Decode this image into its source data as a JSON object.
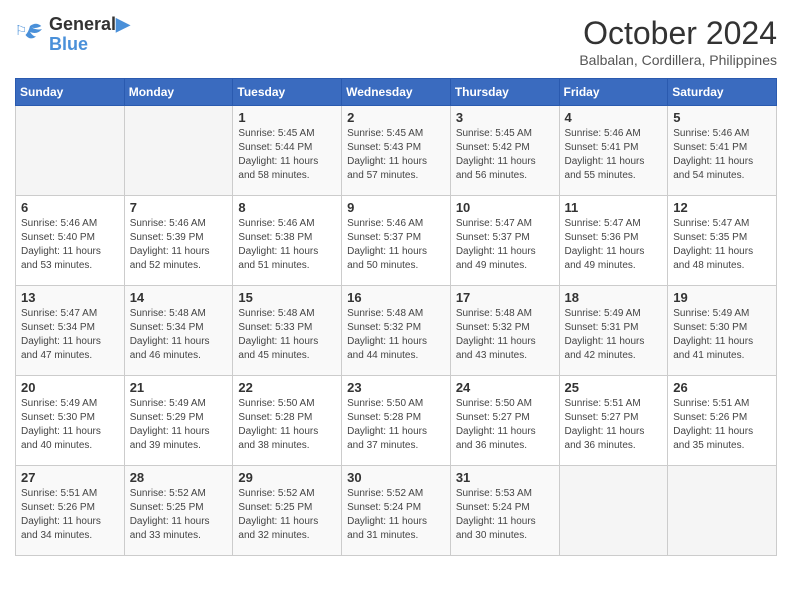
{
  "logo": {
    "line1": "General",
    "line2": "Blue"
  },
  "title": "October 2024",
  "subtitle": "Balbalan, Cordillera, Philippines",
  "weekdays": [
    "Sunday",
    "Monday",
    "Tuesday",
    "Wednesday",
    "Thursday",
    "Friday",
    "Saturday"
  ],
  "weeks": [
    [
      {
        "day": "",
        "info": ""
      },
      {
        "day": "",
        "info": ""
      },
      {
        "day": "1",
        "info": "Sunrise: 5:45 AM\nSunset: 5:44 PM\nDaylight: 11 hours and 58 minutes."
      },
      {
        "day": "2",
        "info": "Sunrise: 5:45 AM\nSunset: 5:43 PM\nDaylight: 11 hours and 57 minutes."
      },
      {
        "day": "3",
        "info": "Sunrise: 5:45 AM\nSunset: 5:42 PM\nDaylight: 11 hours and 56 minutes."
      },
      {
        "day": "4",
        "info": "Sunrise: 5:46 AM\nSunset: 5:41 PM\nDaylight: 11 hours and 55 minutes."
      },
      {
        "day": "5",
        "info": "Sunrise: 5:46 AM\nSunset: 5:41 PM\nDaylight: 11 hours and 54 minutes."
      }
    ],
    [
      {
        "day": "6",
        "info": "Sunrise: 5:46 AM\nSunset: 5:40 PM\nDaylight: 11 hours and 53 minutes."
      },
      {
        "day": "7",
        "info": "Sunrise: 5:46 AM\nSunset: 5:39 PM\nDaylight: 11 hours and 52 minutes."
      },
      {
        "day": "8",
        "info": "Sunrise: 5:46 AM\nSunset: 5:38 PM\nDaylight: 11 hours and 51 minutes."
      },
      {
        "day": "9",
        "info": "Sunrise: 5:46 AM\nSunset: 5:37 PM\nDaylight: 11 hours and 50 minutes."
      },
      {
        "day": "10",
        "info": "Sunrise: 5:47 AM\nSunset: 5:37 PM\nDaylight: 11 hours and 49 minutes."
      },
      {
        "day": "11",
        "info": "Sunrise: 5:47 AM\nSunset: 5:36 PM\nDaylight: 11 hours and 49 minutes."
      },
      {
        "day": "12",
        "info": "Sunrise: 5:47 AM\nSunset: 5:35 PM\nDaylight: 11 hours and 48 minutes."
      }
    ],
    [
      {
        "day": "13",
        "info": "Sunrise: 5:47 AM\nSunset: 5:34 PM\nDaylight: 11 hours and 47 minutes."
      },
      {
        "day": "14",
        "info": "Sunrise: 5:48 AM\nSunset: 5:34 PM\nDaylight: 11 hours and 46 minutes."
      },
      {
        "day": "15",
        "info": "Sunrise: 5:48 AM\nSunset: 5:33 PM\nDaylight: 11 hours and 45 minutes."
      },
      {
        "day": "16",
        "info": "Sunrise: 5:48 AM\nSunset: 5:32 PM\nDaylight: 11 hours and 44 minutes."
      },
      {
        "day": "17",
        "info": "Sunrise: 5:48 AM\nSunset: 5:32 PM\nDaylight: 11 hours and 43 minutes."
      },
      {
        "day": "18",
        "info": "Sunrise: 5:49 AM\nSunset: 5:31 PM\nDaylight: 11 hours and 42 minutes."
      },
      {
        "day": "19",
        "info": "Sunrise: 5:49 AM\nSunset: 5:30 PM\nDaylight: 11 hours and 41 minutes."
      }
    ],
    [
      {
        "day": "20",
        "info": "Sunrise: 5:49 AM\nSunset: 5:30 PM\nDaylight: 11 hours and 40 minutes."
      },
      {
        "day": "21",
        "info": "Sunrise: 5:49 AM\nSunset: 5:29 PM\nDaylight: 11 hours and 39 minutes."
      },
      {
        "day": "22",
        "info": "Sunrise: 5:50 AM\nSunset: 5:28 PM\nDaylight: 11 hours and 38 minutes."
      },
      {
        "day": "23",
        "info": "Sunrise: 5:50 AM\nSunset: 5:28 PM\nDaylight: 11 hours and 37 minutes."
      },
      {
        "day": "24",
        "info": "Sunrise: 5:50 AM\nSunset: 5:27 PM\nDaylight: 11 hours and 36 minutes."
      },
      {
        "day": "25",
        "info": "Sunrise: 5:51 AM\nSunset: 5:27 PM\nDaylight: 11 hours and 36 minutes."
      },
      {
        "day": "26",
        "info": "Sunrise: 5:51 AM\nSunset: 5:26 PM\nDaylight: 11 hours and 35 minutes."
      }
    ],
    [
      {
        "day": "27",
        "info": "Sunrise: 5:51 AM\nSunset: 5:26 PM\nDaylight: 11 hours and 34 minutes."
      },
      {
        "day": "28",
        "info": "Sunrise: 5:52 AM\nSunset: 5:25 PM\nDaylight: 11 hours and 33 minutes."
      },
      {
        "day": "29",
        "info": "Sunrise: 5:52 AM\nSunset: 5:25 PM\nDaylight: 11 hours and 32 minutes."
      },
      {
        "day": "30",
        "info": "Sunrise: 5:52 AM\nSunset: 5:24 PM\nDaylight: 11 hours and 31 minutes."
      },
      {
        "day": "31",
        "info": "Sunrise: 5:53 AM\nSunset: 5:24 PM\nDaylight: 11 hours and 30 minutes."
      },
      {
        "day": "",
        "info": ""
      },
      {
        "day": "",
        "info": ""
      }
    ]
  ]
}
